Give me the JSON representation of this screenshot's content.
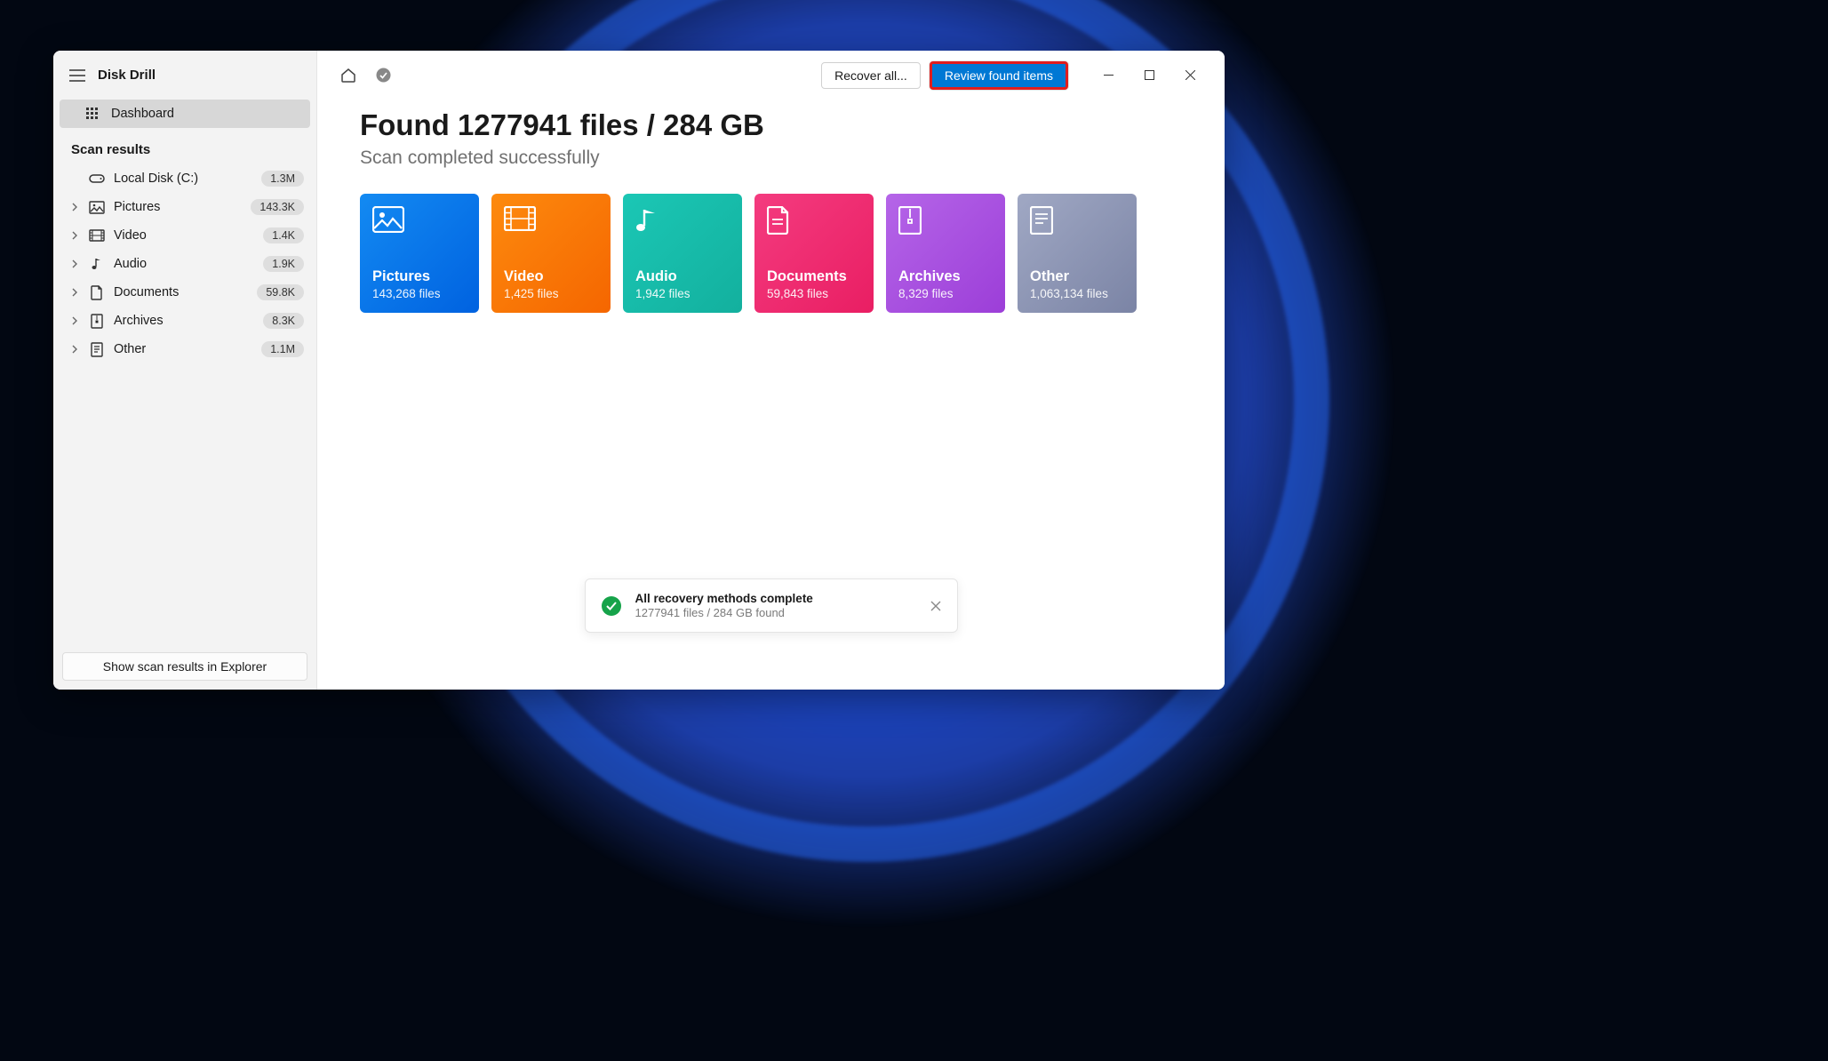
{
  "app": {
    "title": "Disk Drill"
  },
  "sidebar": {
    "dashboard_label": "Dashboard",
    "section_label": "Scan results",
    "items": [
      {
        "label": "Local Disk (C:)",
        "badge": "1.3M"
      },
      {
        "label": "Pictures",
        "badge": "143.3K"
      },
      {
        "label": "Video",
        "badge": "1.4K"
      },
      {
        "label": "Audio",
        "badge": "1.9K"
      },
      {
        "label": "Documents",
        "badge": "59.8K"
      },
      {
        "label": "Archives",
        "badge": "8.3K"
      },
      {
        "label": "Other",
        "badge": "1.1M"
      }
    ],
    "footer_button": "Show scan results in Explorer"
  },
  "toolbar": {
    "recover_all": "Recover all...",
    "review_found": "Review found items"
  },
  "content": {
    "heading": "Found 1277941 files / 284 GB",
    "subheading": "Scan completed successfully",
    "cards": [
      {
        "title": "Pictures",
        "sub": "143,268 files"
      },
      {
        "title": "Video",
        "sub": "1,425 files"
      },
      {
        "title": "Audio",
        "sub": "1,942 files"
      },
      {
        "title": "Documents",
        "sub": "59,843 files"
      },
      {
        "title": "Archives",
        "sub": "8,329 files"
      },
      {
        "title": "Other",
        "sub": "1,063,134 files"
      }
    ]
  },
  "toast": {
    "title": "All recovery methods complete",
    "sub": "1277941 files / 284 GB found"
  }
}
